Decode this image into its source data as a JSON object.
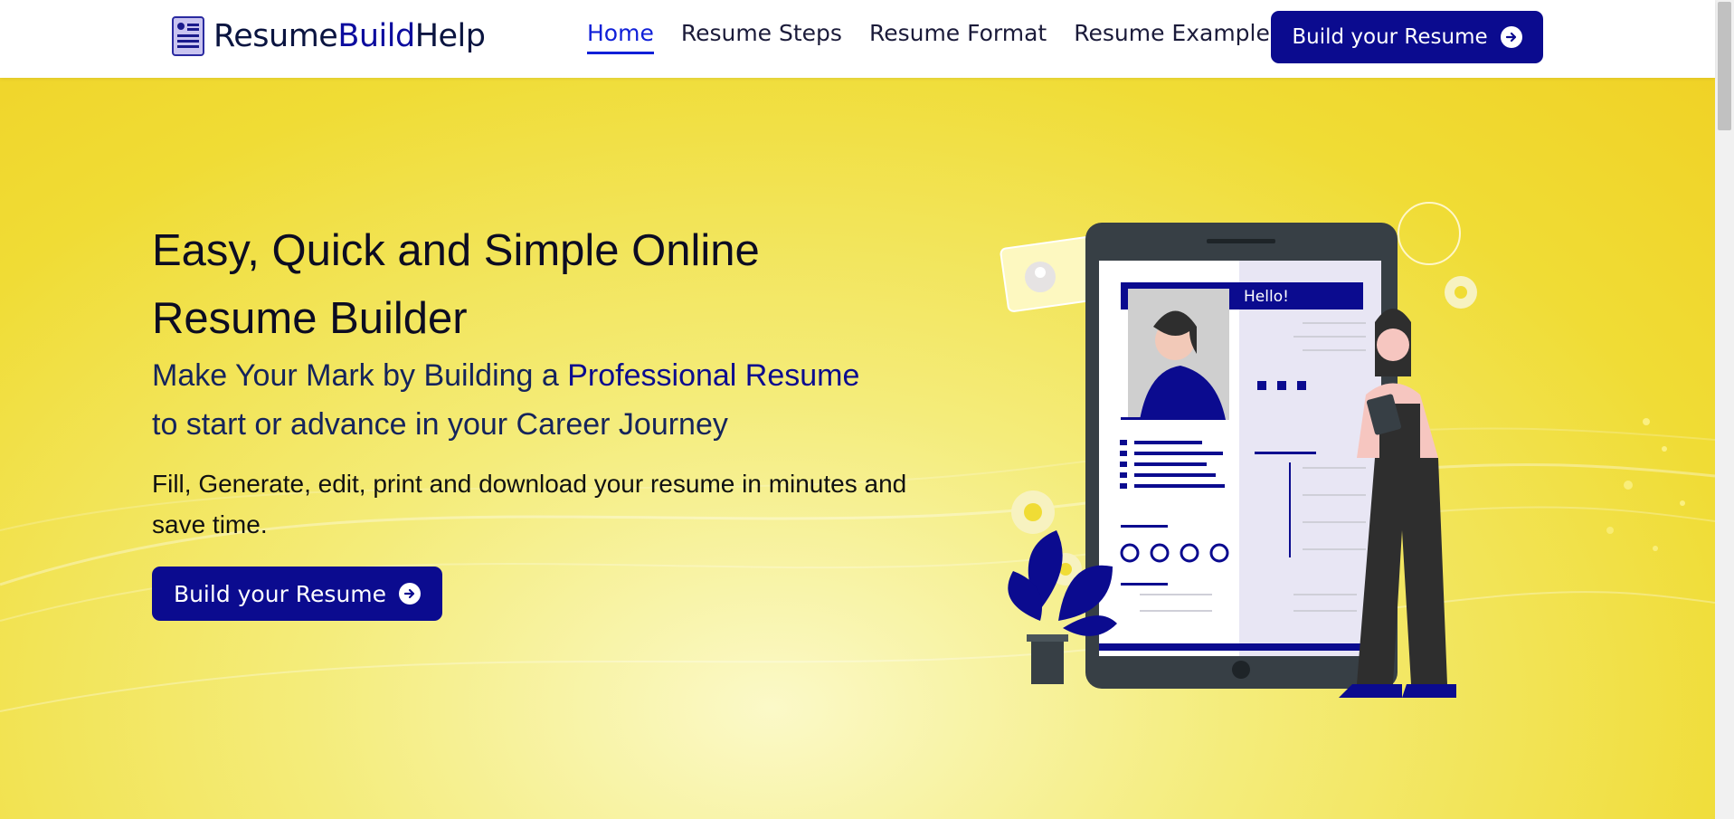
{
  "logo": {
    "part1": "Resume",
    "part2": "Build",
    "part3": "Help",
    "icon": "document-icon"
  },
  "nav": {
    "items": [
      {
        "label": "Home"
      },
      {
        "label": "Resume Steps"
      },
      {
        "label": "Resume Format"
      },
      {
        "label": "Resume Examples"
      }
    ],
    "cta_label": "Build your Resume"
  },
  "hero": {
    "title": "Easy, Quick and Simple Online Resume Builder",
    "subtitle_part1": "Make Your Mark by Building a ",
    "subtitle_highlight": "Professional Resume",
    "subtitle_part2": "to start or advance in your Career Journey",
    "description": "Fill, Generate, edit, print and download your resume in minutes and save time.",
    "cta_label": "Build your Resume"
  },
  "illustration": {
    "greeting": "Hello!"
  },
  "colors": {
    "primary": "#0b0b8f",
    "accent": "#1020d8",
    "hero_bg": "#f0dc35"
  }
}
